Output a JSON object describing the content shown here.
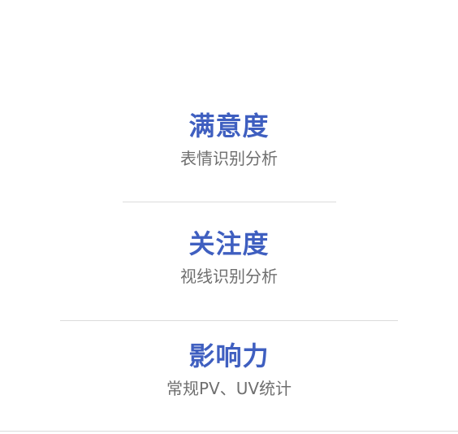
{
  "metrics": [
    {
      "title": "满意度",
      "subtitle": "表情识别分析"
    },
    {
      "title": "关注度",
      "subtitle": "视线识别分析"
    },
    {
      "title": "影响力",
      "subtitle": "常规PV、UV统计"
    }
  ],
  "colors": {
    "title": "#3f5fc0",
    "subtitle": "#6f6f6f",
    "divider": "#dcdcdc",
    "background": "#ffffff"
  }
}
